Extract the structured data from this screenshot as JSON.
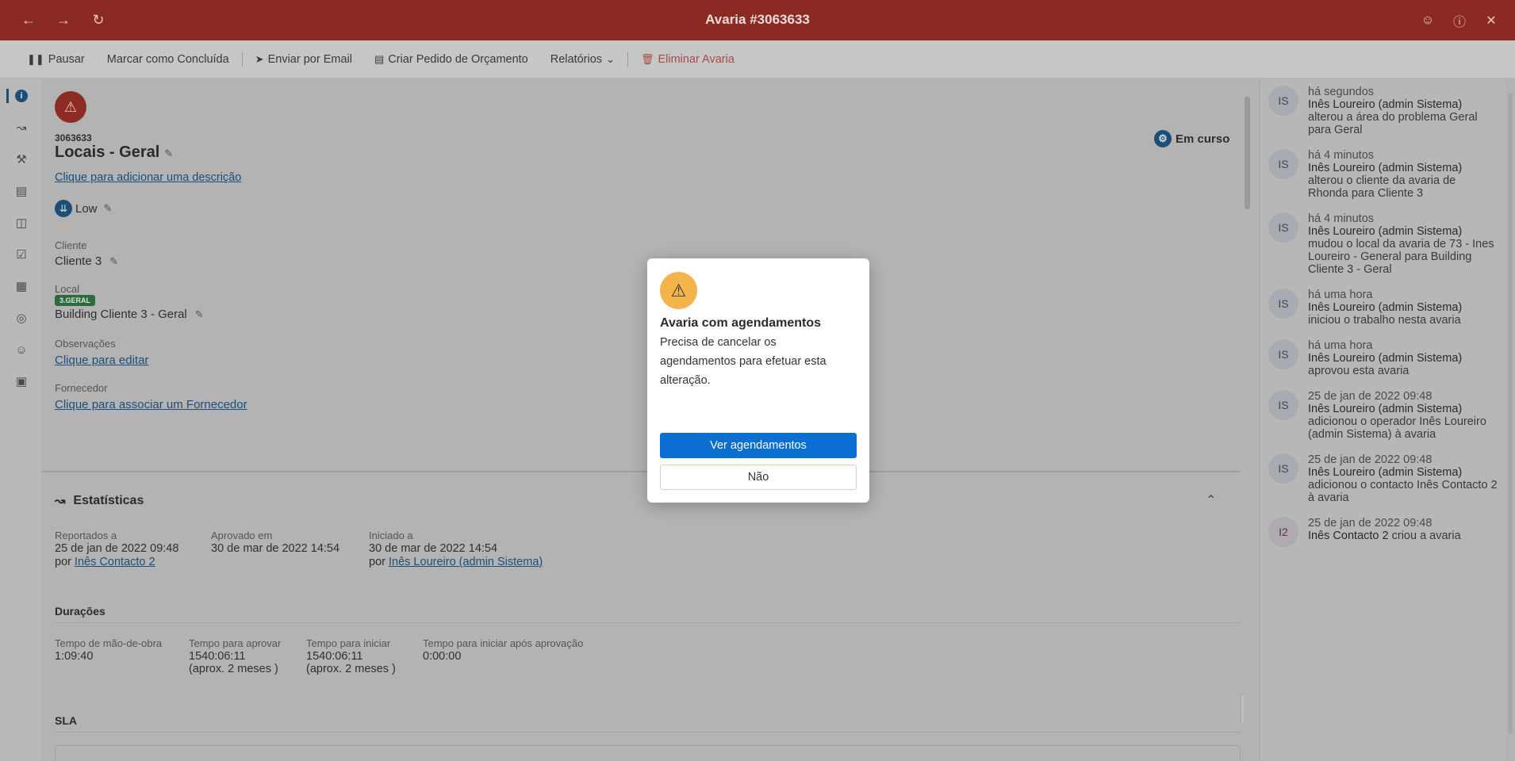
{
  "window": {
    "title": "Avaria #3063633"
  },
  "toolbar": {
    "pause": "Pausar",
    "mark_done": "Marcar como Concluída",
    "email": "Enviar por Email",
    "quote": "Criar Pedido de Orçamento",
    "reports": "Relatórios",
    "delete": "Eliminar Avaria"
  },
  "ticket": {
    "id": "3063633",
    "title": "Locais - Geral",
    "description_link": "Clique para adicionar uma descrição",
    "priority": "Low",
    "status": "Em curso",
    "client_label": "Cliente",
    "client_value": "Cliente 3",
    "location_label": "Local",
    "location_tag": "3.GERAL",
    "location_value": "Building Cliente 3 - Geral",
    "notes_label": "Observações",
    "notes_link": "Clique para editar",
    "supplier_label": "Fornecedor",
    "supplier_link": "Clique para associar um Fornecedor"
  },
  "stats": {
    "title": "Estatísticas",
    "reported_label": "Reportados a",
    "reported_date": "25 de jan de 2022 09:48",
    "reported_by_prefix": "por",
    "reported_by": "Inês Contacto 2",
    "approved_label": "Aprovado em",
    "approved_date": "30 de mar de 2022 14:54",
    "started_label": "Iniciado a",
    "started_date": "30 de mar de 2022 14:54",
    "started_by_prefix": "por",
    "started_by": "Inês Loureiro (admin Sistema)"
  },
  "durations": {
    "title": "Durações",
    "labor_label": "Tempo de mão-de-obra",
    "labor_value": "1:09:40",
    "approve_label": "Tempo para aprovar",
    "approve_value": "1540:06:11",
    "approve_approx": "(aprox. 2 meses )",
    "start_label": "Tempo para iniciar",
    "start_value": "1540:06:11",
    "start_approx": "(aprox. 2 meses )",
    "after_label": "Tempo para iniciar após aprovação",
    "after_value": "0:00:00"
  },
  "sla": {
    "title": "SLA"
  },
  "activity": [
    {
      "avatar": "IS",
      "time": "há segundos",
      "who": "Inês Loureiro (admin Sistema)",
      "text": "alterou a área do problema Geral para Geral"
    },
    {
      "avatar": "IS",
      "time": "há 4 minutos",
      "who": "Inês Loureiro (admin Sistema)",
      "text": "alterou o cliente da avaria de Rhonda para Cliente 3"
    },
    {
      "avatar": "IS",
      "time": "há 4 minutos",
      "who": "Inês Loureiro (admin Sistema)",
      "text": "mudou o local da avaria de 73 - Ines Loureiro - General para Building Cliente 3 - Geral"
    },
    {
      "avatar": "IS",
      "time": "há uma hora",
      "who": "Inês Loureiro (admin Sistema)",
      "text": "iniciou o trabalho nesta avaria"
    },
    {
      "avatar": "IS",
      "time": "há uma hora",
      "who": "Inês Loureiro (admin Sistema)",
      "text": "aprovou esta avaria"
    },
    {
      "avatar": "IS",
      "time": "25 de jan de 2022 09:48",
      "who": "Inês Loureiro (admin Sistema)",
      "text": "adicionou o operador Inês Loureiro (admin Sistema) à avaria"
    },
    {
      "avatar": "IS",
      "time": "25 de jan de 2022 09:48",
      "who": "Inês Loureiro (admin Sistema)",
      "text": "adicionou o contacto Inês Contacto 2 à avaria"
    },
    {
      "avatar": "I2",
      "time": "25 de jan de 2022 09:48",
      "who": "Inês Contacto 2",
      "text": "criou a avaria"
    }
  ],
  "modal": {
    "title": "Avaria com agendamentos",
    "text": "Precisa de cancelar os agendamentos para efetuar esta alteração.",
    "primary": "Ver agendamentos",
    "secondary": "Não"
  },
  "colors": {
    "titlebar": "#8b2a22",
    "accent": "#0a6fd1",
    "warning": "#f5b44a"
  }
}
